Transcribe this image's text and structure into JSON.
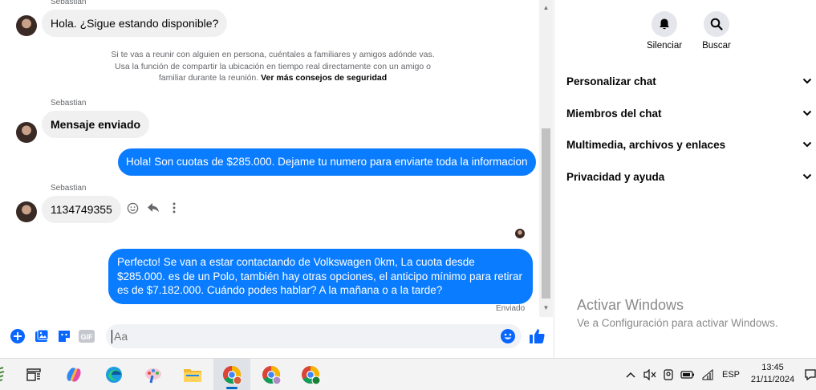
{
  "conversation": {
    "header_sender": "Sebastian",
    "messages": [
      {
        "sender": "Sebastian",
        "text": "Hola. ¿Sigue estando disponible?"
      },
      {
        "sender": "Sebastian",
        "text": "Mensaje enviado"
      },
      {
        "sender": "me",
        "text": "Hola! Son cuotas de $285.000. Dejame tu numero para enviarte toda la informacion"
      },
      {
        "sender": "Sebastian",
        "text": "1134749355"
      },
      {
        "sender": "me",
        "text": "Perfecto!  Se van a estar contactando de Volkswagen 0km, La cuota desde $285.000. es de un Polo, también hay otras opciones, el anticipo mínimo para retirar es de $7.182.000. Cuándo podes hablar? A la mañana o a la tarde?"
      }
    ],
    "sender_label_2": "Sebastian",
    "sender_label_3": "Sebastian",
    "safety_notice": "Si te vas a reunir con alguien en persona, cuéntales a familiares y amigos adónde vas. Usa la función de compartir la ubicación en tiempo real directamente con un amigo o familiar durante la reunión.",
    "safety_link": "Ver más consejos de seguridad",
    "status": "Enviado"
  },
  "composer": {
    "placeholder": "Aa"
  },
  "panel": {
    "actions": [
      {
        "label": "Silenciar",
        "icon": "bell-icon"
      },
      {
        "label": "Buscar",
        "icon": "search-icon"
      }
    ],
    "sections": [
      {
        "label": "Personalizar chat"
      },
      {
        "label": "Miembros del chat"
      },
      {
        "label": "Multimedia, archivos y enlaces"
      },
      {
        "label": "Privacidad y ayuda"
      }
    ]
  },
  "watermark": {
    "title": "Activar Windows",
    "subtitle": "Ve a Configuración para activar Windows."
  },
  "taskbar": {
    "language": "ESP",
    "time": "13:45",
    "date": "21/11/2024"
  },
  "colors": {
    "messenger_blue": "#0a7cff",
    "incoming_bubble": "#f0f0f0",
    "accent_icon": "#0866ff"
  }
}
